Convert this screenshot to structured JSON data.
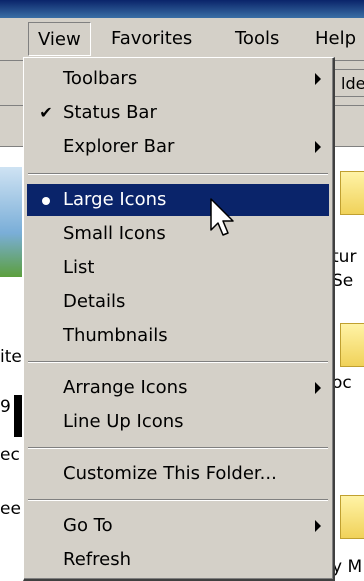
{
  "menubar": {
    "items": [
      {
        "label": "View"
      },
      {
        "label": "Favorites"
      },
      {
        "label": "Tools"
      },
      {
        "label": "Help"
      }
    ]
  },
  "toolbar": {
    "partial_button_label": "lde"
  },
  "view_menu": {
    "items": [
      {
        "label": "Toolbars"
      },
      {
        "label": "Status Bar"
      },
      {
        "label": "Explorer Bar"
      },
      {
        "label": "Large Icons"
      },
      {
        "label": "Small Icons"
      },
      {
        "label": "List"
      },
      {
        "label": "Details"
      },
      {
        "label": "Thumbnails"
      },
      {
        "label": "Arrange Icons"
      },
      {
        "label": "Line Up Icons"
      },
      {
        "label": "Customize This Folder..."
      },
      {
        "label": "Go To"
      },
      {
        "label": "Refresh"
      }
    ],
    "checkmark_glyph": "✔"
  },
  "background": {
    "left_fragments": [
      "ite",
      "9",
      "ec",
      "ee"
    ],
    "right_fragments": [
      "tur",
      "Se",
      "oc",
      "y M"
    ]
  },
  "colors": {
    "menu_face": "#d4d0c8",
    "highlight": "#0a246a",
    "highlight_text": "#ffffff"
  }
}
